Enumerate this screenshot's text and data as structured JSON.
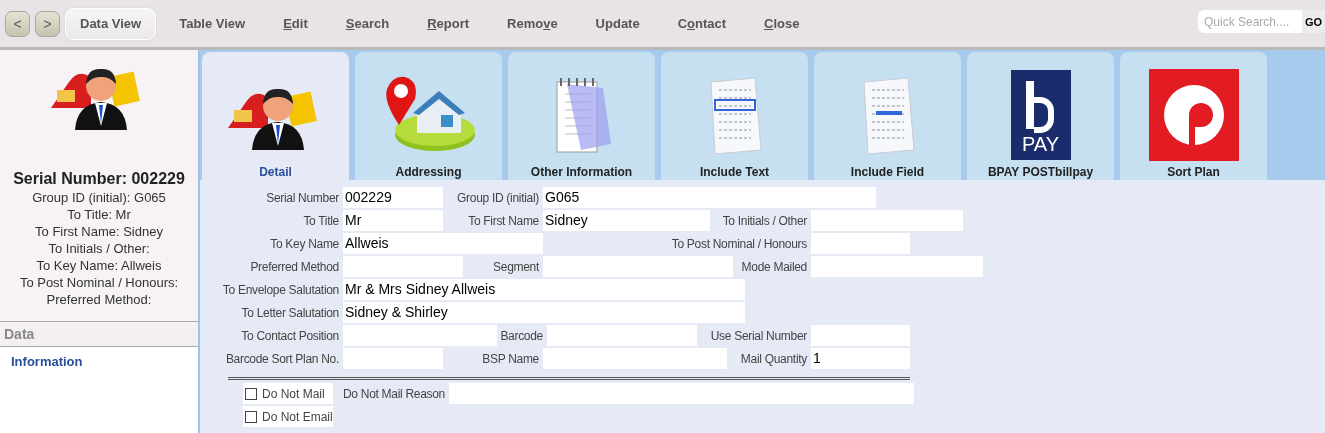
{
  "toolbar": {
    "nav_buttons": [
      {
        "label": "<"
      },
      {
        "label": ">"
      }
    ],
    "menu": [
      {
        "pre": "Data View",
        "selected": true
      },
      {
        "pre": "Table View",
        "selected": false
      },
      {
        "key": "E",
        "post": "dit",
        "selected": false
      },
      {
        "key": "S",
        "post": "earch",
        "selected": false
      },
      {
        "key": "R",
        "post": "eport",
        "selected": false
      },
      {
        "pre": "Remo",
        "key": "v",
        "post": "e",
        "selected": false
      },
      {
        "pre": "Update",
        "selected": false
      },
      {
        "pre": "C",
        "key": "o",
        "post": "ntact",
        "selected": false
      },
      {
        "key": "C",
        "post": "lose",
        "selected": false
      }
    ],
    "quick_search": {
      "placeholder": "Quick Search...."
    },
    "go_button": "GO"
  },
  "sidebar": {
    "heading": "Serial Number: 002229",
    "lines": [
      "Group ID (initial): G065",
      "To Title: Mr",
      "To First Name: Sidney",
      "To Initials / Other:",
      "To Key Name: Allweis",
      "To Post Nominal / Honours:",
      "Preferred Method:"
    ],
    "section": "Data",
    "items": [
      {
        "label": "Information"
      }
    ]
  },
  "tabs": [
    {
      "label": "Detail",
      "kind": "person-mailbox",
      "selected": true
    },
    {
      "label": "Addressing",
      "kind": "pin-house",
      "selected": false
    },
    {
      "label": "Other Information",
      "kind": "notepad",
      "selected": false
    },
    {
      "label": "Include Text",
      "kind": "doc-highlight",
      "selected": false
    },
    {
      "label": "Include Field",
      "kind": "doc-line",
      "selected": false
    },
    {
      "label": "BPAY POSTbillpay",
      "kind": "bpay",
      "logo_text": "PAY",
      "selected": false
    },
    {
      "label": "Sort Plan",
      "kind": "post",
      "selected": false
    }
  ],
  "form": {
    "rows": [
      [
        {
          "label": "Serial Number",
          "value": "002229"
        },
        {
          "label": "Group ID (initial)",
          "value": "G065"
        }
      ],
      [
        {
          "label": "To Title",
          "value": "Mr"
        },
        {
          "label": "To First Name",
          "value": "Sidney"
        },
        {
          "label": "To Initials / Other"
        }
      ],
      [
        {
          "label": "To Key Name",
          "value": "Allweis"
        },
        {
          "blank": true
        },
        {
          "label": "To Post Nominal / Honours"
        }
      ],
      [
        {
          "label": "Preferred Method"
        },
        {
          "label": "Segment"
        },
        {
          "label": "Mode Mailed"
        }
      ],
      [
        {
          "label": "To Envelope Salutation",
          "value": "Mr & Mrs Sidney Allweis"
        }
      ],
      [
        {
          "label": "To Letter Salutation",
          "value": "Sidney & Shirley"
        }
      ],
      [
        {
          "label": "To Contact Position"
        },
        {
          "label": "Barcode"
        },
        {
          "label": "Use Serial Number"
        }
      ],
      [
        {
          "label": "Barcode Sort Plan No."
        },
        {
          "label": "BSP Name"
        },
        {
          "label": "Mail Quantity",
          "value": "1"
        }
      ]
    ],
    "checks": [
      {
        "label": "Do Not Mail",
        "checked": false
      },
      {
        "label": "Do Not Email",
        "checked": false
      }
    ],
    "reason_label": "Do Not Mail Reason"
  }
}
